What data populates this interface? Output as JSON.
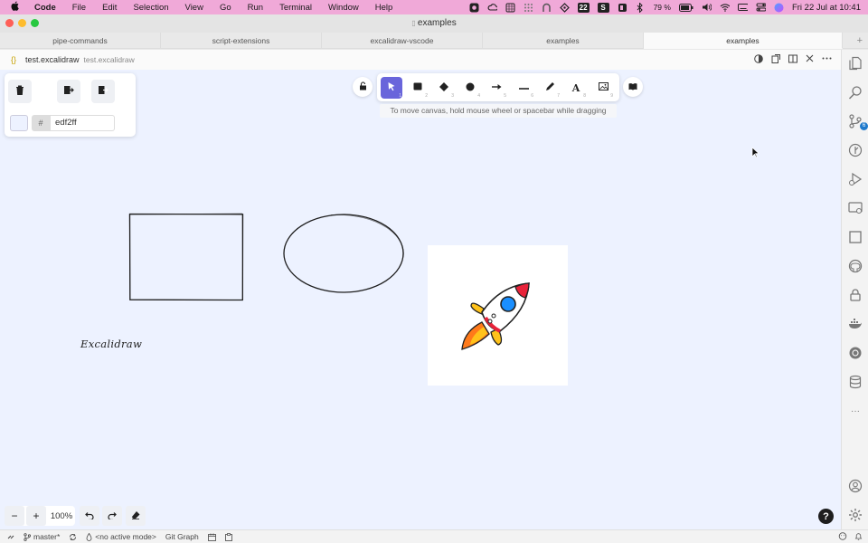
{
  "menubar": {
    "app": "Code",
    "items": [
      "File",
      "Edit",
      "Selection",
      "View",
      "Go",
      "Run",
      "Terminal",
      "Window",
      "Help"
    ],
    "calendar_badge": "22",
    "s_badge": "S",
    "battery": "79 %",
    "datetime": "Fri 22 Jul at  10:41"
  },
  "window": {
    "title": "examples"
  },
  "tabs": [
    {
      "label": "pipe-commands",
      "active": false
    },
    {
      "label": "script-extensions",
      "active": false
    },
    {
      "label": "excalidraw-vscode",
      "active": false
    },
    {
      "label": "examples",
      "active": true
    }
  ],
  "tab_add": "+",
  "editor": {
    "file_icon": "{}",
    "file_name": "test.excalidraw",
    "file_desc": "test.excalidraw"
  },
  "properties": {
    "background_hex": "edf2ff",
    "hash_label": "#",
    "swatch_color": "#edf2ff"
  },
  "toolbar": {
    "tools": [
      {
        "name": "selection",
        "key": "1",
        "active": true
      },
      {
        "name": "rectangle",
        "key": "2",
        "active": false
      },
      {
        "name": "diamond",
        "key": "3",
        "active": false
      },
      {
        "name": "ellipse",
        "key": "4",
        "active": false
      },
      {
        "name": "arrow",
        "key": "5",
        "active": false
      },
      {
        "name": "line",
        "key": "6",
        "active": false
      },
      {
        "name": "draw",
        "key": "7",
        "active": false
      },
      {
        "name": "text",
        "key": "8",
        "active": false
      },
      {
        "name": "image",
        "key": "9",
        "active": false
      }
    ],
    "text_glyph": "A",
    "hint": "To move canvas, hold mouse wheel or spacebar while dragging"
  },
  "canvas": {
    "background": "#edf2ff",
    "text_element": "Excalidraw"
  },
  "zoom": {
    "minus": "−",
    "plus": "+",
    "level": "100%"
  },
  "help": "?",
  "activity_bar": {
    "scm_badge": "6",
    "more": "···"
  },
  "statusbar": {
    "branch": "master*",
    "mode": "<no active mode>",
    "git_graph": "Git Graph"
  },
  "colors": {
    "accent": "#6965db",
    "menubar": "#f0a9d8",
    "canvas": "#edf2ff"
  }
}
